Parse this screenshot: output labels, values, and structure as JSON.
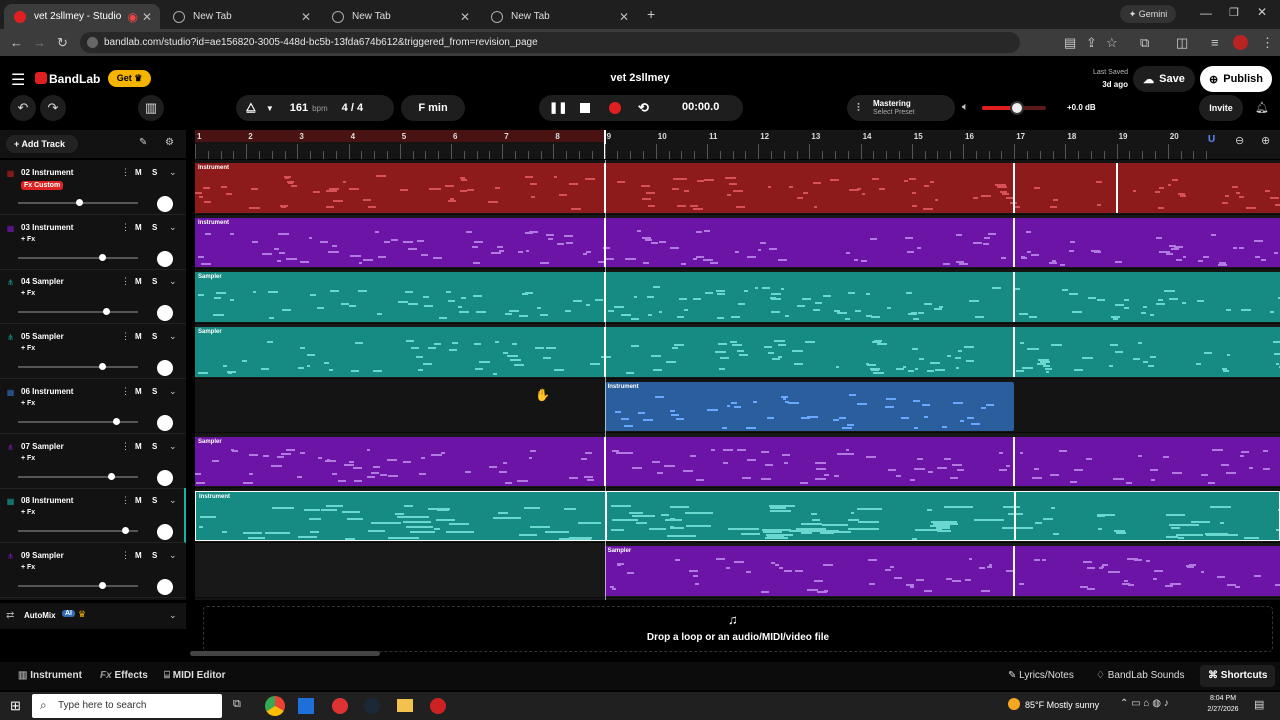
{
  "browser": {
    "tabs": [
      {
        "title": "vet 2sllmey - Studio",
        "active": true
      },
      {
        "title": "New Tab",
        "active": false
      },
      {
        "title": "New Tab",
        "active": false
      },
      {
        "title": "New Tab",
        "active": false
      }
    ],
    "gemini_label": "Gemini",
    "url": "bandlab.com/studio?id=ae156820-3005-448d-bc5b-13fda674b612&triggered_from=revision_page"
  },
  "header": {
    "brand": "BandLab",
    "get_label": "Get",
    "project_title": "vet 2sllmey",
    "last_saved_label": "Last Saved",
    "last_saved_value": "3d ago",
    "save_label": "Save",
    "publish_label": "Publish"
  },
  "transport": {
    "bpm_value": "161",
    "bpm_unit": "bpm",
    "time_signature": "4 / 4",
    "key": "F min",
    "time": "00:00.0",
    "mastering_label": "Mastering",
    "mastering_preset": "Select Preset",
    "volume_db": "+0.0 dB",
    "invite_label": "Invite",
    "master_volume": 0.55
  },
  "add_track_label": "Add Track",
  "ruler_bars": [
    "1",
    "2",
    "3",
    "4",
    "5",
    "6",
    "7",
    "8",
    "9",
    "10",
    "11",
    "12",
    "13",
    "14",
    "15",
    "16",
    "17",
    "18",
    "19",
    "20"
  ],
  "tracks": [
    {
      "name": "02 Instrument",
      "fx": "Fx Custom",
      "fx_custom": true,
      "color": "#b52020",
      "volume": 0.5,
      "icon": "piano-icon"
    },
    {
      "name": "03 Instrument",
      "fx": "+ Fx",
      "fx_custom": false,
      "color": "#7a18b8",
      "volume": 0.7,
      "icon": "piano-icon"
    },
    {
      "name": "04 Sampler",
      "fx": "+ Fx",
      "fx_custom": false,
      "color": "#179e95",
      "volume": 0.73,
      "icon": "sampler-icon"
    },
    {
      "name": "05 Sampler",
      "fx": "+ Fx",
      "fx_custom": false,
      "color": "#179e95",
      "volume": 0.7,
      "icon": "sampler-icon"
    },
    {
      "name": "06 Instrument",
      "fx": "+ Fx",
      "fx_custom": false,
      "color": "#2e6cb8",
      "volume": 0.82,
      "icon": "piano-icon"
    },
    {
      "name": "07 Sampler",
      "fx": "+ Fx",
      "fx_custom": false,
      "color": "#7a18b8",
      "volume": 0.78,
      "icon": "sampler-icon"
    },
    {
      "name": "08 Instrument",
      "fx": "+ Fx",
      "fx_custom": false,
      "color": "#179e95",
      "volume": 0.9,
      "icon": "piano-icon"
    },
    {
      "name": "09 Sampler",
      "fx": "+ Fx",
      "fx_custom": false,
      "color": "#7a18b8",
      "volume": 0.7,
      "icon": "sampler-icon"
    }
  ],
  "track_buttons": {
    "mute": "M",
    "solo": "S"
  },
  "clip_labels": {
    "instrument": "Instrument",
    "sampler": "Sampler"
  },
  "automix_label": "AutoMix",
  "automix_badge": "AI",
  "drop_zone_text": "Drop a loop or an audio/MIDI/video file",
  "bottom": {
    "instrument": "Instrument",
    "effects": "Effects",
    "midi_editor": "MIDI Editor",
    "lyrics": "Lyrics/Notes",
    "sounds": "BandLab Sounds",
    "shortcuts": "Shortcuts"
  },
  "taskbar": {
    "search_placeholder": "Type here to search",
    "weather": "85°F  Mostly sunny",
    "clock_time": "8:04 PM",
    "clock_date": "2/27/2026"
  },
  "colors": {
    "accent_red": "#e02020",
    "get_yellow": "#f5b400"
  }
}
